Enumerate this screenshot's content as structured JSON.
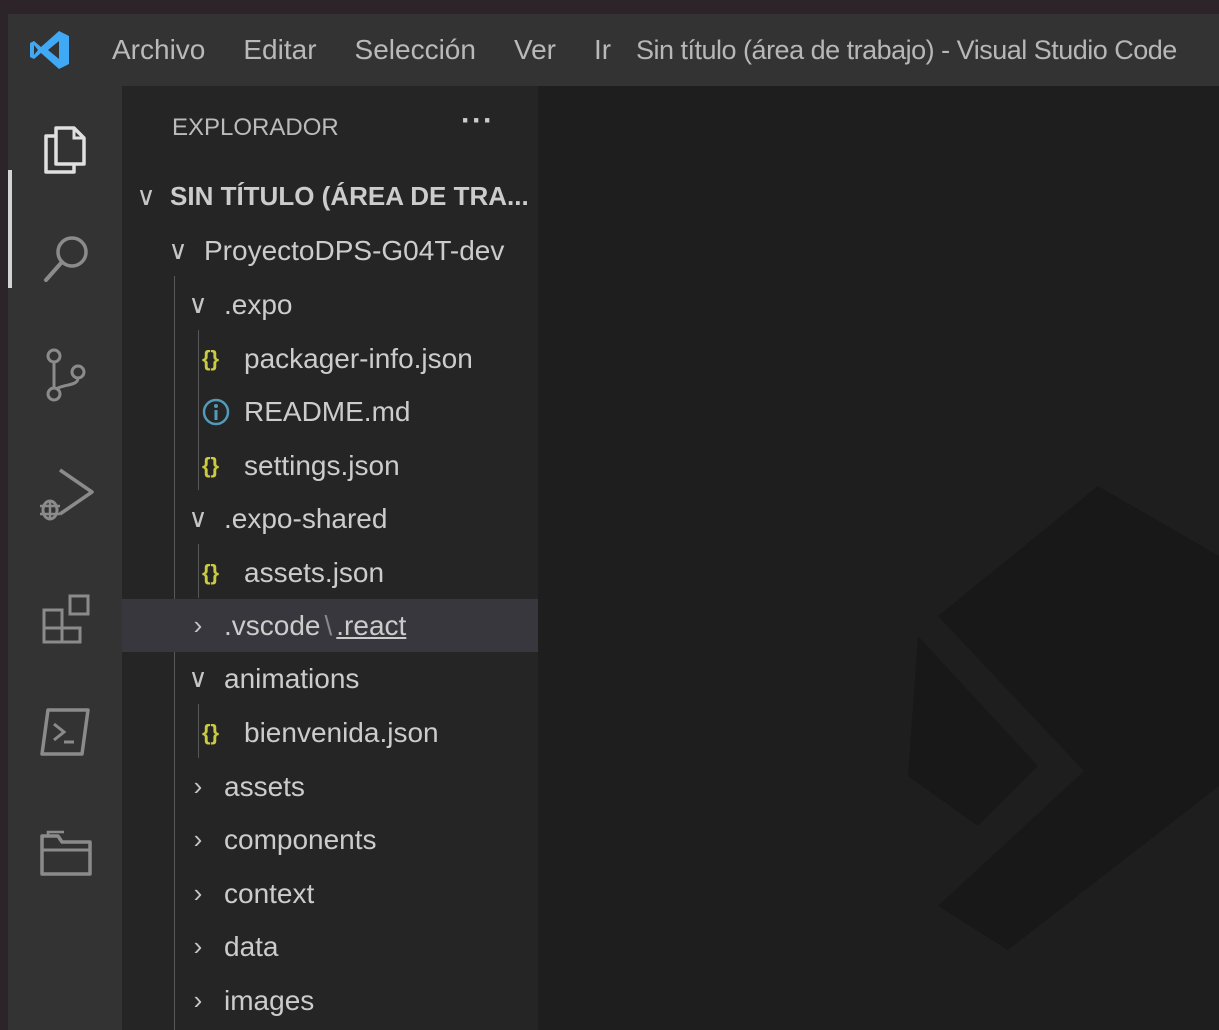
{
  "title_bar": {
    "logo_icon": "vscode-logo-icon",
    "menu": [
      "Archivo",
      "Editar",
      "Selección",
      "Ver",
      "Ir"
    ],
    "window_title": "Sin título (área de trabajo) - Visual Studio Code"
  },
  "activity_bar": {
    "items": [
      {
        "name": "explorer-icon",
        "active": true
      },
      {
        "name": "search-icon"
      },
      {
        "name": "source-control-icon"
      },
      {
        "name": "run-debug-icon"
      },
      {
        "name": "extensions-icon"
      },
      {
        "name": "terminal-icon"
      },
      {
        "name": "folder-icon"
      }
    ]
  },
  "sidebar": {
    "title": "EXPLORADOR",
    "more_label": "···",
    "workspace": "SIN TÍTULO (ÁREA DE TRA...",
    "tree": [
      {
        "label": "ProyectoDPS-G04T-dev",
        "type": "folder",
        "expanded": true
      },
      {
        "label": ".expo",
        "type": "folder",
        "expanded": true
      },
      {
        "label": "packager-info.json",
        "type": "json"
      },
      {
        "label": "README.md",
        "type": "info"
      },
      {
        "label": "settings.json",
        "type": "json"
      },
      {
        "label": ".expo-shared",
        "type": "folder",
        "expanded": true
      },
      {
        "label": "assets.json",
        "type": "json"
      },
      {
        "label": ".vscode",
        "label_sep": "\\",
        "label_b": ".react",
        "type": "folder",
        "expanded": false,
        "selected": true
      },
      {
        "label": "animations",
        "type": "folder",
        "expanded": true
      },
      {
        "label": "bienvenida.json",
        "type": "json"
      },
      {
        "label": "assets",
        "type": "folder",
        "expanded": false
      },
      {
        "label": "components",
        "type": "folder",
        "expanded": false
      },
      {
        "label": "context",
        "type": "folder",
        "expanded": false
      },
      {
        "label": "data",
        "type": "folder",
        "expanded": false
      },
      {
        "label": "images",
        "type": "folder",
        "expanded": false
      }
    ],
    "json_glyph": "{}"
  },
  "colors": {
    "accent_blue": "#3fa9f5",
    "json_yellow": "#cbcb41",
    "info_blue": "#519aba",
    "selection": "#37373d"
  }
}
